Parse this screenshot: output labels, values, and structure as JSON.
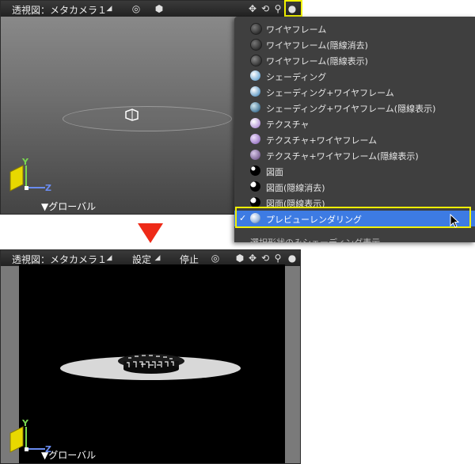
{
  "top_viewport": {
    "title": "透視図：メタカメラ１",
    "global_label": "▼グローバル",
    "axis": {
      "y": "Y",
      "z": "Z"
    }
  },
  "shading_menu": {
    "items": [
      {
        "label": "ワイヤフレーム",
        "icon": "wireframe-sphere-icon",
        "selected": false
      },
      {
        "label": "ワイヤフレーム(隠線消去)",
        "icon": "wireframe-hidden-removed-icon",
        "selected": false
      },
      {
        "label": "ワイヤフレーム(隠線表示)",
        "icon": "wireframe-hidden-shown-icon",
        "selected": false
      },
      {
        "label": "シェーディング",
        "icon": "shading-sphere-icon",
        "selected": false
      },
      {
        "label": "シェーディング+ワイヤフレーム",
        "icon": "shading-wireframe-icon",
        "selected": false
      },
      {
        "label": "シェーディング+ワイヤフレーム(隠線表示)",
        "icon": "shading-wireframe-hidden-icon",
        "selected": false
      },
      {
        "label": "テクスチャ",
        "icon": "texture-sphere-icon",
        "selected": false
      },
      {
        "label": "テクスチャ+ワイヤフレーム",
        "icon": "texture-wireframe-icon",
        "selected": false
      },
      {
        "label": "テクスチャ+ワイヤフレーム(隠線表示)",
        "icon": "texture-wireframe-hidden-icon",
        "selected": false
      },
      {
        "label": "図面",
        "icon": "drawing-sphere-icon",
        "selected": false
      },
      {
        "label": "図面(隠線消去)",
        "icon": "drawing-hidden-removed-icon",
        "selected": false
      },
      {
        "label": "図面(隠線表示)",
        "icon": "drawing-hidden-shown-icon",
        "selected": false
      },
      {
        "label": "プレビューレンダリング",
        "icon": "preview-render-sphere-icon",
        "selected": true
      }
    ],
    "checkmark": "✓",
    "cut_off_item": "選択形状のみシェーディング表示"
  },
  "bottom_viewport": {
    "title": "透視図：メタカメラ１",
    "settings_label": "設定",
    "stop_label": "停止",
    "global_label": "▼グローバル",
    "axis": {
      "y": "Y",
      "z": "Z"
    }
  },
  "colors": {
    "highlight": "#f2f200",
    "menu_selected": "#3d7be3",
    "arrow": "#ee2a18",
    "axis_y": "#7ad850",
    "axis_z": "#6a8cf0"
  }
}
